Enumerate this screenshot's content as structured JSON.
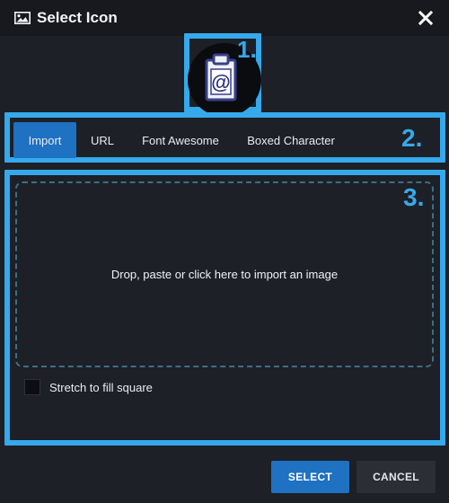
{
  "dialog": {
    "title": "Select Icon",
    "title_icon": "image-icon",
    "close_icon": "close-icon"
  },
  "preview": {
    "icon": "clipboard-at-icon",
    "symbol": "@"
  },
  "annotations": [
    "1.",
    "2.",
    "3."
  ],
  "tabs": [
    {
      "label": "Import",
      "active": true
    },
    {
      "label": "URL",
      "active": false
    },
    {
      "label": "Font Awesome",
      "active": false
    },
    {
      "label": "Boxed Character",
      "active": false
    }
  ],
  "import": {
    "dropzone_text": "Drop, paste or click here to import an image",
    "stretch_label": "Stretch to fill square",
    "stretch_checked": false
  },
  "actions": {
    "select_label": "SELECT",
    "cancel_label": "CANCEL"
  },
  "colors": {
    "accent": "#1f71c2",
    "annotation": "#35a9ec",
    "background": "#1d2026",
    "titlebar": "#17191e"
  }
}
